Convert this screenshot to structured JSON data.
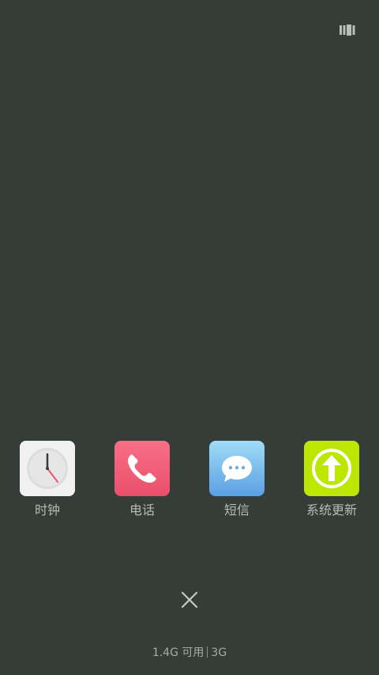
{
  "apps": [
    {
      "name": "clock",
      "label": "时钟",
      "icon": "clock-icon",
      "color": "#f1f1f1"
    },
    {
      "name": "phone",
      "label": "电话",
      "icon": "phone-icon",
      "color": "#f0556f"
    },
    {
      "name": "messages",
      "label": "短信",
      "icon": "message-bubble-icon",
      "color": "#6aaee8"
    },
    {
      "name": "system-update",
      "label": "系统更新",
      "icon": "arrow-up-circle-icon",
      "color": "#b7e000"
    }
  ],
  "footer": {
    "memory": "1.4G 可用",
    "network": "3G"
  },
  "icons": {
    "view_toggle": "grid-view-icon",
    "close": "close-icon"
  },
  "colors": {
    "background": "#353d39",
    "label_text": "#b5bcb8"
  }
}
